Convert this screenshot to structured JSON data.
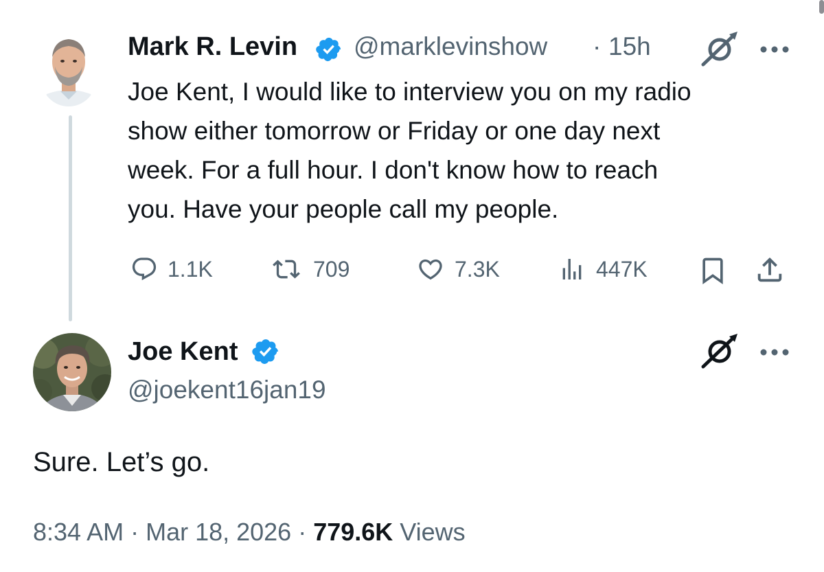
{
  "tweet": {
    "author": {
      "name": "Mark R. Levin",
      "handle": "@marklevinshow",
      "verified": true
    },
    "separator": "·",
    "time": "15h",
    "text": "Joe Kent, I would like to interview you on my radio\nshow either tomorrow or Friday or one day next\nweek.  For a full hour.  I don't know how to reach\nyou.  Have your people call my people.",
    "actions": {
      "replies": "1.1K",
      "reposts": "709",
      "likes": "7.3K",
      "views": "447K"
    }
  },
  "reply": {
    "author": {
      "name": "Joe Kent",
      "handle": "@joekent16jan19",
      "verified": true
    },
    "text": "Sure. Let’s go.",
    "timestamp": "8:34 AM · Mar 18, 2026 · ",
    "views_count": "779.6K",
    "views_label": " Views"
  },
  "icons": {
    "grok": "slashed-circle-icon",
    "more": "more-dots-icon",
    "reply": "reply-icon",
    "repost": "repost-icon",
    "like": "like-icon",
    "analytics": "analytics-icon",
    "bookmark": "bookmark-icon",
    "share": "share-icon",
    "verified": "verified-badge-icon"
  },
  "colors": {
    "verified_blue": "#1d9bf0",
    "secondary_text": "#536471",
    "primary_text": "#0f1419",
    "thread_line": "#cfd9de"
  }
}
